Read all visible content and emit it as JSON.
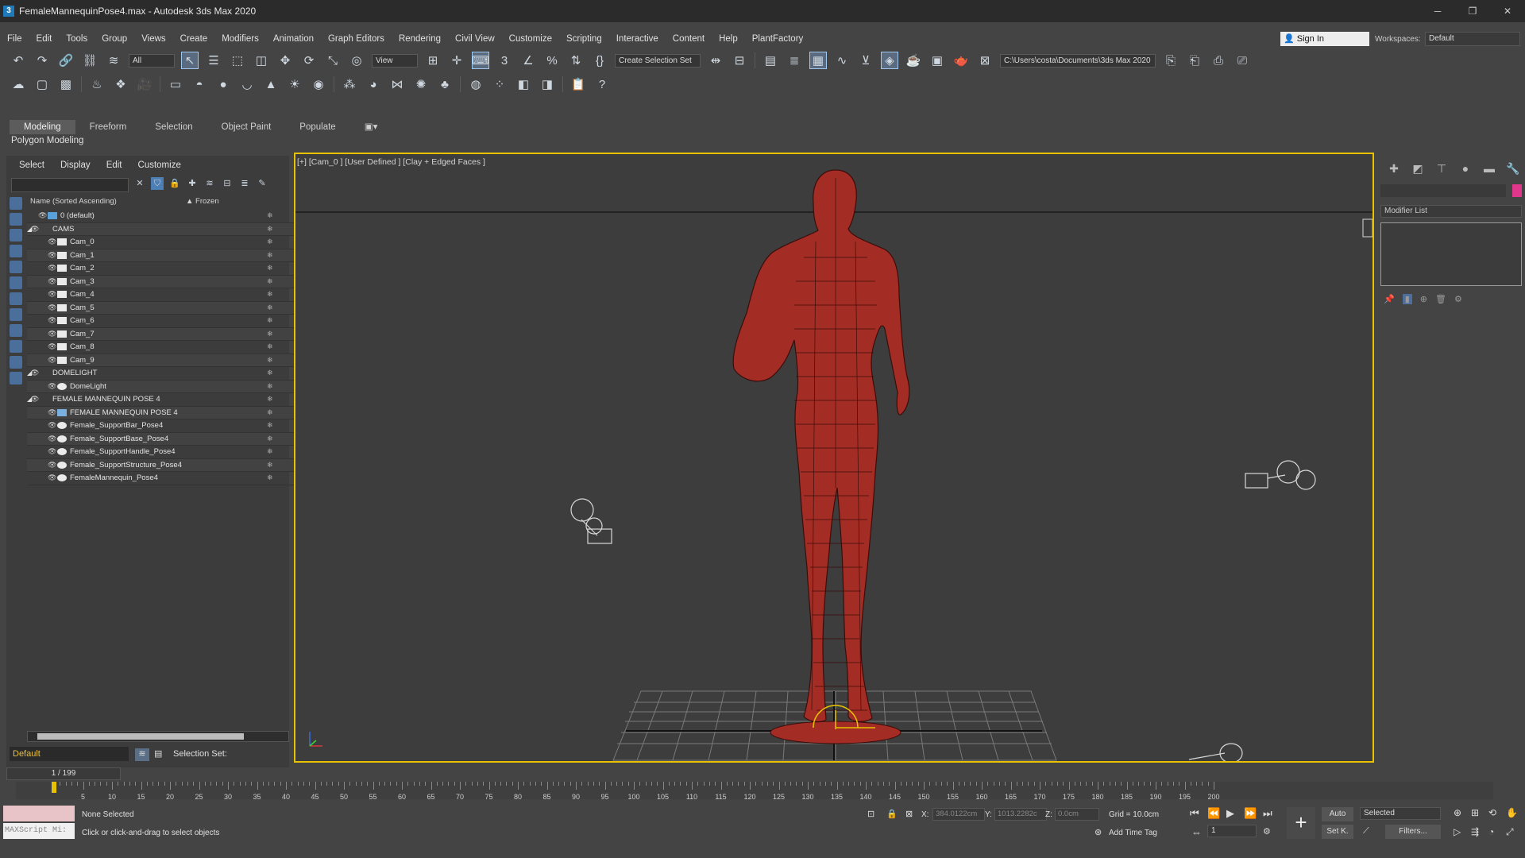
{
  "window": {
    "title": "FemaleMannequinPose4.max - Autodesk 3ds Max 2020",
    "app_logo": "3",
    "controls": [
      "─",
      "❐",
      "✕"
    ]
  },
  "menubar": {
    "items": [
      "File",
      "Edit",
      "Tools",
      "Group",
      "Views",
      "Create",
      "Modifiers",
      "Animation",
      "Graph Editors",
      "Rendering",
      "Civil View",
      "Customize",
      "Scripting",
      "Interactive",
      "Content",
      "Help",
      "PlantFactory"
    ],
    "sign_in": "Sign In",
    "workspaces_label": "Workspaces:",
    "workspace_value": "Default"
  },
  "toolbar": {
    "filter_value": "All",
    "view_value": "View",
    "selection_set": "Create Selection Set",
    "path": "C:\\Users\\costa\\Documents\\3ds Max 2020"
  },
  "ribbon": {
    "tabs": [
      "Modeling",
      "Freeform",
      "Selection",
      "Object Paint",
      "Populate"
    ],
    "active_tab": "Modeling",
    "sub_label": "Polygon Modeling"
  },
  "scene_explorer": {
    "menu": [
      "Select",
      "Display",
      "Edit",
      "Customize"
    ],
    "col_name": "Name (Sorted Ascending)",
    "col_frozen": "▲ Frozen",
    "rows": [
      {
        "label": "0 (default)",
        "level": 1,
        "type": "layer"
      },
      {
        "label": "CAMS",
        "level": 0,
        "type": "group"
      },
      {
        "label": "Cam_0",
        "level": 2,
        "type": "cam"
      },
      {
        "label": "Cam_1",
        "level": 2,
        "type": "cam"
      },
      {
        "label": "Cam_2",
        "level": 2,
        "type": "cam"
      },
      {
        "label": "Cam_3",
        "level": 2,
        "type": "cam"
      },
      {
        "label": "Cam_4",
        "level": 2,
        "type": "cam"
      },
      {
        "label": "Cam_5",
        "level": 2,
        "type": "cam"
      },
      {
        "label": "Cam_6",
        "level": 2,
        "type": "cam"
      },
      {
        "label": "Cam_7",
        "level": 2,
        "type": "cam"
      },
      {
        "label": "Cam_8",
        "level": 2,
        "type": "cam"
      },
      {
        "label": "Cam_9",
        "level": 2,
        "type": "cam"
      },
      {
        "label": "DOMELIGHT",
        "level": 0,
        "type": "group"
      },
      {
        "label": "DomeLight",
        "level": 2,
        "type": "light"
      },
      {
        "label": "FEMALE MANNEQUIN POSE 4",
        "level": 0,
        "type": "group"
      },
      {
        "label": "FEMALE MANNEQUIN POSE 4",
        "level": 2,
        "type": "mesh"
      },
      {
        "label": "Female_SupportBar_Pose4",
        "level": 2,
        "type": "sphere"
      },
      {
        "label": "Female_SupportBase_Pose4",
        "level": 2,
        "type": "sphere"
      },
      {
        "label": "Female_SupportHandle_Pose4",
        "level": 2,
        "type": "sphere"
      },
      {
        "label": "Female_SupportStructure_Pose4",
        "level": 2,
        "type": "sphere"
      },
      {
        "label": "FemaleMannequin_Pose4",
        "level": 2,
        "type": "sphere"
      }
    ],
    "layer_name": "Default",
    "selection_set_label": "Selection Set:"
  },
  "viewport": {
    "label": "[+] [Cam_0 ] [User Defined ] [Clay + Edged Faces ]",
    "mesh_color": "#a32d25",
    "border_color": "#e6c200"
  },
  "command_panel": {
    "modifier_list": "Modifier List",
    "object_color": "#e0368c"
  },
  "timeline": {
    "frame_display": "1 / 199",
    "ticks": [
      5,
      10,
      15,
      20,
      25,
      30,
      35,
      40,
      45,
      50,
      55,
      60,
      65,
      70,
      75,
      80,
      85,
      90,
      95,
      100,
      105,
      110,
      115,
      120,
      125,
      130,
      135,
      140,
      145,
      150,
      155,
      160,
      165,
      170,
      175,
      180,
      185,
      190,
      195,
      200
    ]
  },
  "status": {
    "maxscript": "MAXScript Mi:",
    "selection": "None Selected",
    "prompt": "Click or click-and-drag to select objects",
    "x_label": "X:",
    "x_value": "384.0122cm",
    "y_label": "Y:",
    "y_value": "1013.2282c",
    "z_label": "Z:",
    "z_value": "0.0cm",
    "grid": "Grid = 10.0cm",
    "add_time_tag": "Add Time Tag",
    "auto": "Auto",
    "set_key": "Set K.",
    "selected": "Selected",
    "filters": "Filters...",
    "frame": "1"
  }
}
